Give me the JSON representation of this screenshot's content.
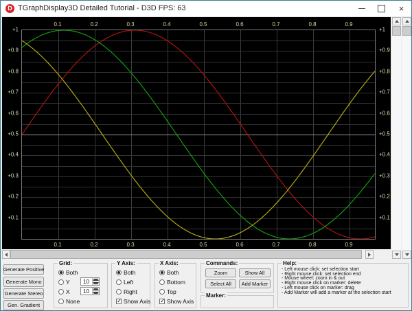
{
  "window": {
    "title": "TGraphDisplay3D Detailed Tutorial - D3D FPS: 63",
    "icon_letter": "D",
    "controls": {
      "minimize": "minimize",
      "maximize": "maximize",
      "close": "×"
    }
  },
  "chart_data": {
    "type": "line",
    "background": "#000000",
    "tick_label_color": "#d8d8ac",
    "x_axis": {
      "position": "both",
      "range": [
        0,
        0.97
      ],
      "tick_labels": [
        "0.1",
        "0.2",
        "0.3",
        "0.4",
        "0.5",
        "0.6",
        "0.7",
        "0.8",
        "0.9"
      ],
      "tick_values": [
        0.1,
        0.2,
        0.3,
        0.4,
        0.5,
        0.6,
        0.7,
        0.8,
        0.9
      ]
    },
    "y_axis": {
      "position": "both",
      "range": [
        0,
        1
      ],
      "tick_labels": [
        "+1",
        "+0.9",
        "+0.8",
        "+0.7",
        "+0.6",
        "+0.5",
        "+0.4",
        "+0.3",
        "+0.2",
        "+0.1"
      ],
      "tick_values": [
        1,
        0.9,
        0.8,
        0.7,
        0.6,
        0.5,
        0.4,
        0.3,
        0.2,
        0.1
      ]
    },
    "grid": {
      "x_step": 0.1,
      "y_step": 0.05,
      "highlight_line_y": 0.5,
      "color_vertical": "#3c3c3c",
      "color_horizontal": "#323232",
      "highlight_color": "#9a9a9a"
    },
    "series": [
      {
        "name": "red-sine",
        "color": "#ad1212",
        "model": "y = offset + amplitude*sin(2*pi*(x+phase)/period)",
        "offset": 0.5,
        "amplitude": 0.5,
        "period": 1.24,
        "phase": 0.0,
        "sample_x": [
          0,
          0.1,
          0.2,
          0.3,
          0.4,
          0.5,
          0.6,
          0.7,
          0.8,
          0.9,
          0.97
        ],
        "sample_y": [
          0.5,
          0.74,
          0.92,
          1.0,
          0.95,
          0.79,
          0.55,
          0.3,
          0.1,
          0.01,
          0.01
        ]
      },
      {
        "name": "green-sine",
        "color": "#0f9e0f",
        "model": "y = offset + amplitude*sin(2*pi*(x+phase)/period)",
        "offset": 0.5,
        "amplitude": 0.5,
        "period": 1.24,
        "phase": 0.195,
        "sample_x": [
          0,
          0.1,
          0.2,
          0.3,
          0.4,
          0.5,
          0.6,
          0.7,
          0.8,
          0.9,
          0.97
        ],
        "sample_y": [
          0.92,
          1.0,
          0.95,
          0.8,
          0.56,
          0.31,
          0.11,
          0.01,
          0.03,
          0.16,
          0.31
        ]
      },
      {
        "name": "yellow-sine",
        "color": "#b1a711",
        "model": "y = offset + amplitude*sin(2*pi*(x+phase)/period)",
        "offset": 0.5,
        "amplitude": 0.5,
        "period": 1.24,
        "phase": 0.399,
        "sample_x": [
          0,
          0.1,
          0.2,
          0.3,
          0.4,
          0.5,
          0.6,
          0.7,
          0.8,
          0.9,
          0.97
        ],
        "sample_y": [
          0.95,
          0.79,
          0.55,
          0.31,
          0.11,
          0.01,
          0.03,
          0.17,
          0.4,
          0.65,
          0.8
        ]
      }
    ]
  },
  "panel": {
    "generator_buttons": [
      {
        "label": "Generate Positive"
      },
      {
        "label": "Generate Mono"
      },
      {
        "label": "Generate Stereo"
      },
      {
        "label": "Gen. Gradient"
      }
    ],
    "grid_group": {
      "caption": "Grid:",
      "options": [
        {
          "label": "Both",
          "selected": true
        },
        {
          "label": "Y",
          "selected": false
        },
        {
          "label": "X",
          "selected": false
        },
        {
          "label": "None",
          "selected": false
        }
      ],
      "y_count": "10",
      "x_count": "10"
    },
    "y_axis_group": {
      "caption": "Y Axis:",
      "options": [
        {
          "label": "Both",
          "selected": true
        },
        {
          "label": "Left",
          "selected": false
        },
        {
          "label": "Right",
          "selected": false
        }
      ],
      "show_axis": {
        "label": "Show Axis",
        "checked": true
      }
    },
    "x_axis_group": {
      "caption": "X Axis:",
      "options": [
        {
          "label": "Both",
          "selected": true
        },
        {
          "label": "Bottom",
          "selected": false
        },
        {
          "label": "Top",
          "selected": false
        }
      ],
      "show_axis": {
        "label": "Show Axis",
        "checked": true
      }
    },
    "commands_group": {
      "caption": "Commands:",
      "buttons": [
        {
          "label": "Zoom"
        },
        {
          "label": "Show All"
        },
        {
          "label": "Select All"
        },
        {
          "label": "Add Marker"
        }
      ]
    },
    "marker_group": {
      "caption": "Marker:"
    },
    "help_group": {
      "caption": "Help:",
      "lines": [
        "- Left mouse click: set selection start",
        "- Right mouse click: set selection end",
        "- Mouse wheel: zoom in & out",
        "- Right mouse click on marker: delete",
        "- Left mouse click on marker: drag",
        "- Add Marker will add a marker at the selection start"
      ]
    }
  }
}
